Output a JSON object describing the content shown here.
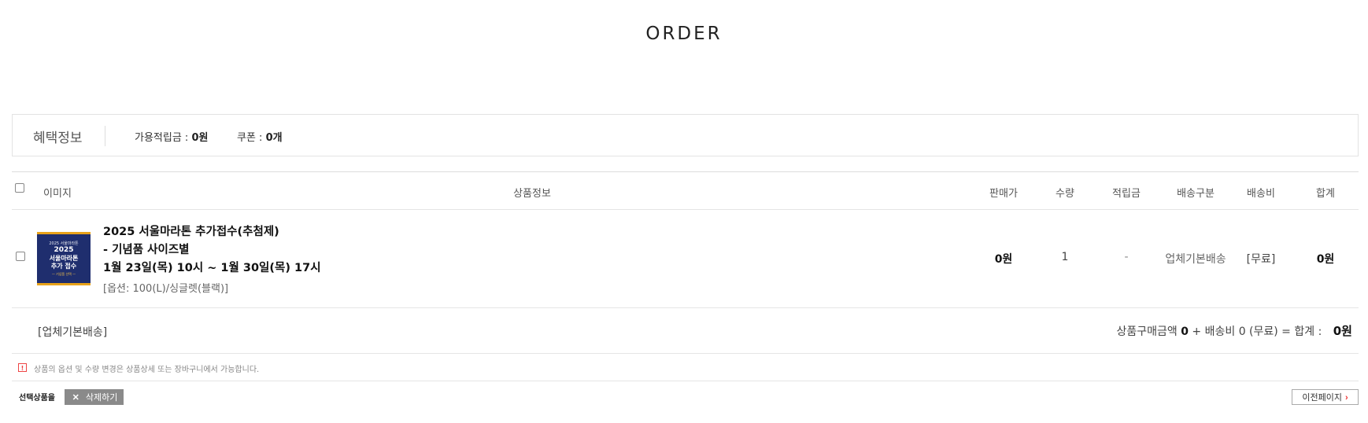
{
  "page": {
    "title": "ORDER"
  },
  "benefit": {
    "title": "혜택정보",
    "mileage_label": "가용적립금 : ",
    "mileage_value": "0원",
    "coupon_label": "쿠폰 : ",
    "coupon_value": "0개"
  },
  "table": {
    "headers": {
      "image": "이미지",
      "info": "상품정보",
      "price": "판매가",
      "qty": "수량",
      "points": "적립금",
      "ship_type": "배송구분",
      "ship_fee": "배송비",
      "total": "합계"
    },
    "rows": [
      {
        "thumb": {
          "t1": "2025 서울마라톤",
          "t2": "2025",
          "t3a": "서울마라톤",
          "t3b": "추가 접수",
          "t4": "— 기념품 선택 —"
        },
        "name_line1": "2025 서울마라톤 추가접수(추첨제)",
        "name_line2": "- 기념품 사이즈별",
        "name_line3": "1월 23일(목) 10시 ~ 1월 30일(목) 17시",
        "option": "[옵션: 100(L)/싱글렛(블랙)]",
        "price": "0원",
        "qty": "1",
        "points": "-",
        "ship_type": "업체기본배송",
        "ship_fee": "[무료]",
        "total": "0원"
      }
    ]
  },
  "summary": {
    "ship_group": "[업체기본배송]",
    "purchase_label": "상품구매금액 ",
    "purchase_value": "0",
    "ship_label": " + 배송비 0 (무료) = 합계 : ",
    "total": "0원"
  },
  "notice": {
    "icon": "!",
    "text": "상품의 옵션 및 수량 변경은 상품상세 또는 장바구니에서 가능합니다."
  },
  "actions": {
    "selected_label": "선택상품을",
    "delete_label": "삭제하기",
    "prev_label": "이전페이지"
  },
  "colors": {
    "thumb_bg": "#1f2e6e",
    "thumb_accent": "#e8a21a",
    "delete_btn": "#8a8a8a",
    "chevron": "#e33333"
  }
}
